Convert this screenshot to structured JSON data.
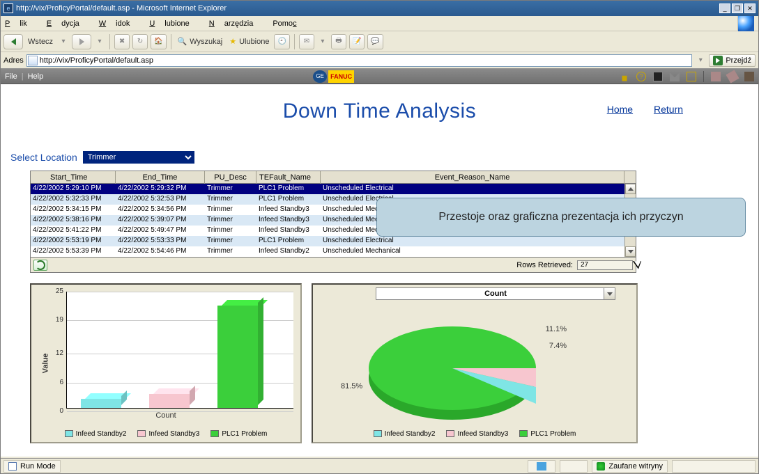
{
  "window": {
    "title": "http://vix/ProficyPortal/default.asp - Microsoft Internet Explorer"
  },
  "menus": {
    "plik": "Plik",
    "edycja": "Edycja",
    "widok": "Widok",
    "ulubione": "Ulubione",
    "narzedzia": "Narzędzia",
    "pomoc": "Pomoc"
  },
  "toolbar": {
    "back": "Wstecz",
    "search": "Wyszukaj",
    "favorites": "Ulubione"
  },
  "address": {
    "label": "Adres",
    "value": "http://vix/ProficyPortal/default.asp",
    "go": "Przejdź"
  },
  "portal": {
    "file": "File",
    "help": "Help",
    "fanuc": "FANUC"
  },
  "page": {
    "title": "Down Time Analysis",
    "links": {
      "home": "Home",
      "return": "Return"
    },
    "select_location_label": "Select Location",
    "select_location_value": "Trimmer"
  },
  "grid": {
    "headers": {
      "start": "Start_Time",
      "end": "End_Time",
      "pu": "PU_Desc",
      "fault": "TEFault_Name",
      "reason": "Event_Reason_Name"
    },
    "rows": [
      {
        "start": "4/22/2002 5:29:10 PM",
        "end": "4/22/2002 5:29:32 PM",
        "pu": "Trimmer",
        "fault": "PLC1 Problem",
        "reason": "Unscheduled Electrical"
      },
      {
        "start": "4/22/2002 5:32:33 PM",
        "end": "4/22/2002 5:32:53 PM",
        "pu": "Trimmer",
        "fault": "PLC1 Problem",
        "reason": "Unscheduled Electrical"
      },
      {
        "start": "4/22/2002 5:34:15 PM",
        "end": "4/22/2002 5:34:56 PM",
        "pu": "Trimmer",
        "fault": "Infeed Standby3",
        "reason": "Unscheduled Mechanical"
      },
      {
        "start": "4/22/2002 5:38:16 PM",
        "end": "4/22/2002 5:39:07 PM",
        "pu": "Trimmer",
        "fault": "Infeed Standby3",
        "reason": "Unscheduled Mechanical"
      },
      {
        "start": "4/22/2002 5:41:22 PM",
        "end": "4/22/2002 5:49:47 PM",
        "pu": "Trimmer",
        "fault": "Infeed Standby3",
        "reason": "Unscheduled Mechanical"
      },
      {
        "start": "4/22/2002 5:53:19 PM",
        "end": "4/22/2002 5:53:33 PM",
        "pu": "Trimmer",
        "fault": "PLC1 Problem",
        "reason": "Unscheduled Electrical"
      },
      {
        "start": "4/22/2002 5:53:39 PM",
        "end": "4/22/2002 5:54:46 PM",
        "pu": "Trimmer",
        "fault": "Infeed Standby2",
        "reason": "Unscheduled Mechanical"
      }
    ],
    "rows_retrieved_label": "Rows Retrieved:",
    "rows_retrieved_value": "27"
  },
  "chart_data": [
    {
      "type": "bar",
      "ylabel": "Value",
      "xlabel": "Count",
      "ylim": [
        0,
        25
      ],
      "yticks": [
        0,
        6,
        12,
        19,
        25
      ],
      "categories": [
        "Infeed Standby2",
        "Infeed Standby3",
        "PLC1 Problem"
      ],
      "values": [
        2,
        3,
        22
      ],
      "colors": [
        "#7fe5e5",
        "#f7c6cf",
        "#3bcf3b"
      ]
    },
    {
      "type": "pie",
      "title": "Count",
      "slices": [
        {
          "name": "PLC1 Problem",
          "pct": 81.5,
          "label": "81.5%",
          "color": "#3bcf3b"
        },
        {
          "name": "Infeed Standby3",
          "pct": 11.1,
          "label": "11.1%",
          "color": "#f7c6cf"
        },
        {
          "name": "Infeed Standby2",
          "pct": 7.4,
          "label": "7.4%",
          "color": "#7fe5e5"
        }
      ],
      "legend": [
        "Infeed Standby2",
        "Infeed Standby3",
        "PLC1 Problem"
      ]
    }
  ],
  "callout": {
    "text": "Przestoje oraz graficzna prezentacja ich przyczyn"
  },
  "status": {
    "run_mode": "Run Mode",
    "trusted": "Zaufane witryny"
  }
}
